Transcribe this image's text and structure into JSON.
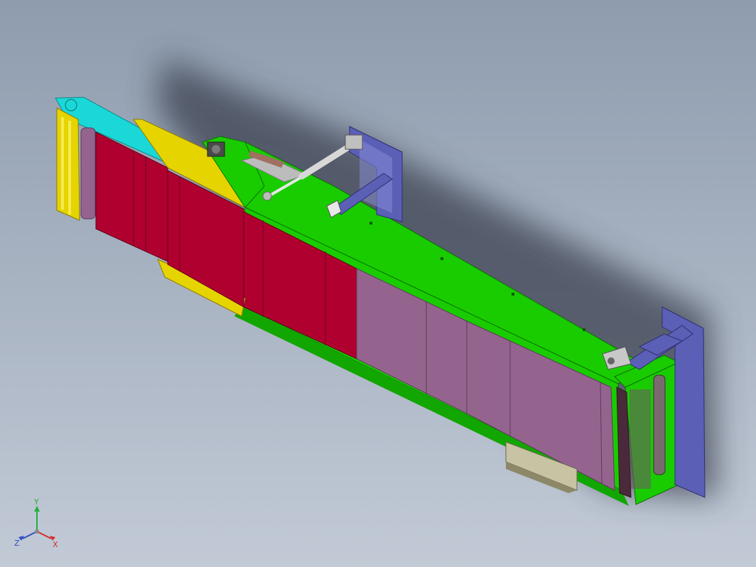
{
  "viewport": {
    "background_top": "#8e9cae",
    "background_bottom": "#c2cad6"
  },
  "model": {
    "colors": {
      "conveyor_body": "#19cc00",
      "conveyor_body_shade": "#12a600",
      "red_panel": "#b00030",
      "purple_panel": "#94648f",
      "yellow_section": "#e6d400",
      "cyan_section": "#1ad8d8",
      "bracket": "#5b5fb5",
      "cylinder": "#d8d8d8",
      "plate": "#bcbcbc",
      "drive_box": "#c8c3a3"
    }
  },
  "triad": {
    "x_label": "X",
    "y_label": "Y",
    "z_label": "Z",
    "x_color": "#d03030",
    "y_color": "#20b040",
    "z_color": "#3050c0"
  }
}
